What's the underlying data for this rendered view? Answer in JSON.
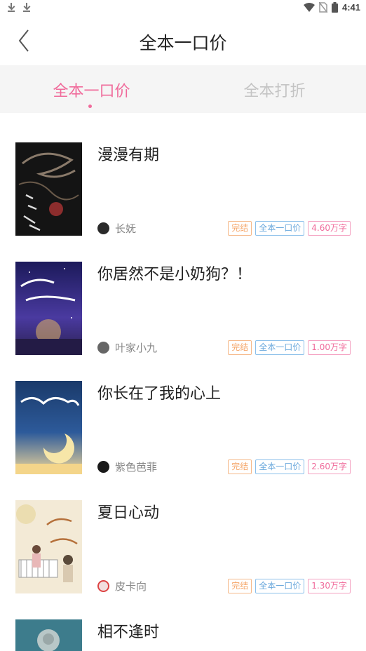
{
  "status_bar": {
    "left_icons": [
      "download-icon",
      "download-icon"
    ],
    "right_icons": [
      "wifi-icon",
      "no-sim-icon",
      "battery-icon"
    ],
    "time": "4:41"
  },
  "header": {
    "back_icon": "chevron-left-icon",
    "title": "全本一口价"
  },
  "tabs": [
    {
      "label": "全本一口价",
      "active": true
    },
    {
      "label": "全本打折",
      "active": false
    }
  ],
  "colors": {
    "accent": "#f06b9b",
    "status_tag": "#f5a76a",
    "price_tag": "#6aa8dc"
  },
  "books": [
    {
      "title": "漫漫有期",
      "author": "长妩",
      "status": "完结",
      "price_type": "全本一口价",
      "words": "4.60万字"
    },
    {
      "title": "你居然不是小奶狗？！",
      "author": "叶家小九",
      "status": "完结",
      "price_type": "全本一口价",
      "words": "1.00万字"
    },
    {
      "title": "你长在了我的心上",
      "author": "紫色芭菲",
      "status": "完结",
      "price_type": "全本一口价",
      "words": "2.60万字"
    },
    {
      "title": "夏日心动",
      "author": "皮卡向",
      "status": "完结",
      "price_type": "全本一口价",
      "words": "1.30万字"
    },
    {
      "title": "相不逢时"
    }
  ]
}
